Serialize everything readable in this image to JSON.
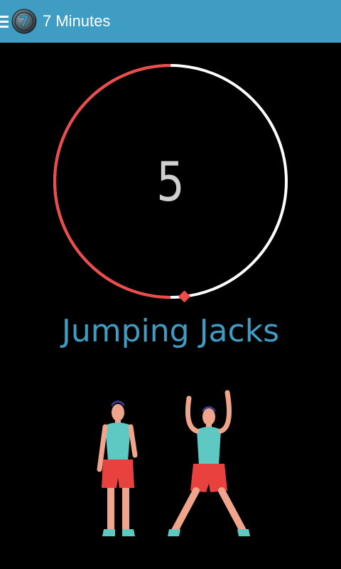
{
  "app": {
    "title": "7 Minutes",
    "logo_text": "7"
  },
  "colors": {
    "action_bar": "#3f9dc4",
    "timer_elapsed": "#f04a49",
    "timer_remaining": "#ffffff",
    "exercise_name": "#3f9dc4"
  },
  "timer": {
    "count": "5",
    "elapsed_fraction": 0.5
  },
  "exercise": {
    "name": "Jumping Jacks",
    "illustration_icon": "jumping-jacks-figure-icon"
  }
}
